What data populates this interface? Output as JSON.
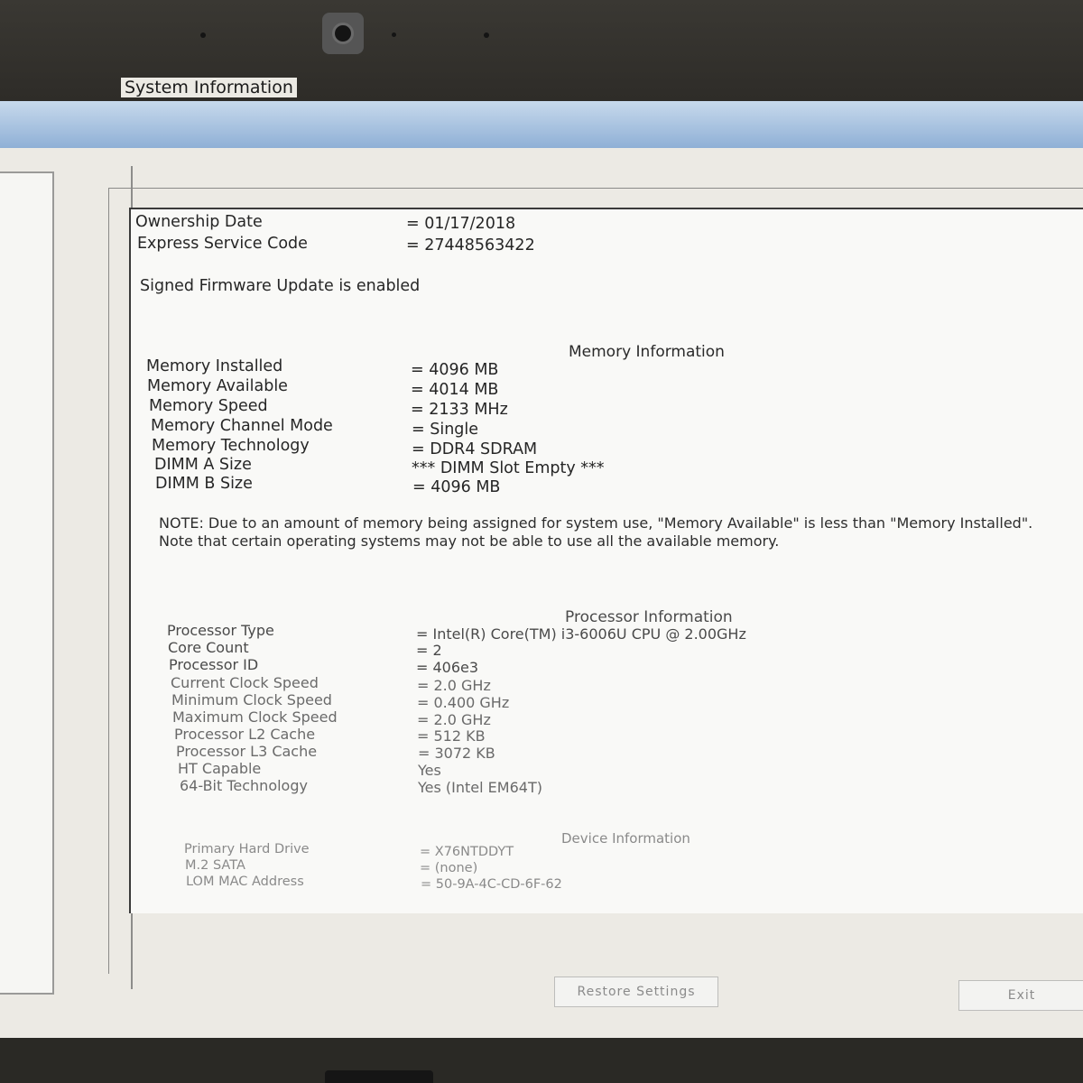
{
  "window": {
    "group_title": "System Information"
  },
  "ownership": [
    {
      "label": "Ownership Date",
      "value": "= 01/17/2018"
    },
    {
      "label": "Express Service Code",
      "value": "= 27448563422"
    }
  ],
  "firmware_status": "Signed Firmware Update is enabled",
  "memory": {
    "title": "Memory Information",
    "rows": [
      {
        "label": "Memory Installed",
        "value": "= 4096 MB"
      },
      {
        "label": "Memory Available",
        "value": "= 4014 MB"
      },
      {
        "label": "Memory Speed",
        "value": "= 2133 MHz"
      },
      {
        "label": "Memory Channel Mode",
        "value": "= Single"
      },
      {
        "label": "Memory Technology",
        "value": "= DDR4 SDRAM"
      },
      {
        "label": "DIMM A Size",
        "value": "*** DIMM Slot Empty ***"
      },
      {
        "label": "DIMM B Size",
        "value": "= 4096 MB"
      }
    ]
  },
  "note": "NOTE: Due to an amount of memory being assigned for system use, \"Memory Available\" is less than \"Memory Installed\". Note that certain operating systems may not be able to use all the available memory.",
  "processor": {
    "title": "Processor Information",
    "rows": [
      {
        "label": "Processor Type",
        "value": "= Intel(R) Core(TM) i3-6006U CPU @ 2.00GHz"
      },
      {
        "label": "Core Count",
        "value": "= 2"
      },
      {
        "label": "Processor ID",
        "value": "= 406e3"
      },
      {
        "label": "Current Clock Speed",
        "value": "= 2.0 GHz"
      },
      {
        "label": "Minimum Clock Speed",
        "value": "= 0.400 GHz"
      },
      {
        "label": "Maximum Clock Speed",
        "value": "= 2.0 GHz"
      },
      {
        "label": "Processor L2 Cache",
        "value": "= 512 KB"
      },
      {
        "label": "Processor L3 Cache",
        "value": "= 3072 KB"
      },
      {
        "label": "HT Capable",
        "value": "Yes"
      },
      {
        "label": "64-Bit Technology",
        "value": "Yes (Intel EM64T)"
      }
    ]
  },
  "device": {
    "title": "Device Information",
    "rows": [
      {
        "label": "Primary Hard Drive",
        "value": "= X76NTDDYT"
      },
      {
        "label": "M.2 SATA",
        "value": "= (none)"
      },
      {
        "label": "LOM MAC Address",
        "value": "= 50-9A-4C-CD-6F-62"
      }
    ]
  },
  "buttons": {
    "restore": "Restore Settings",
    "exit": "Exit"
  }
}
